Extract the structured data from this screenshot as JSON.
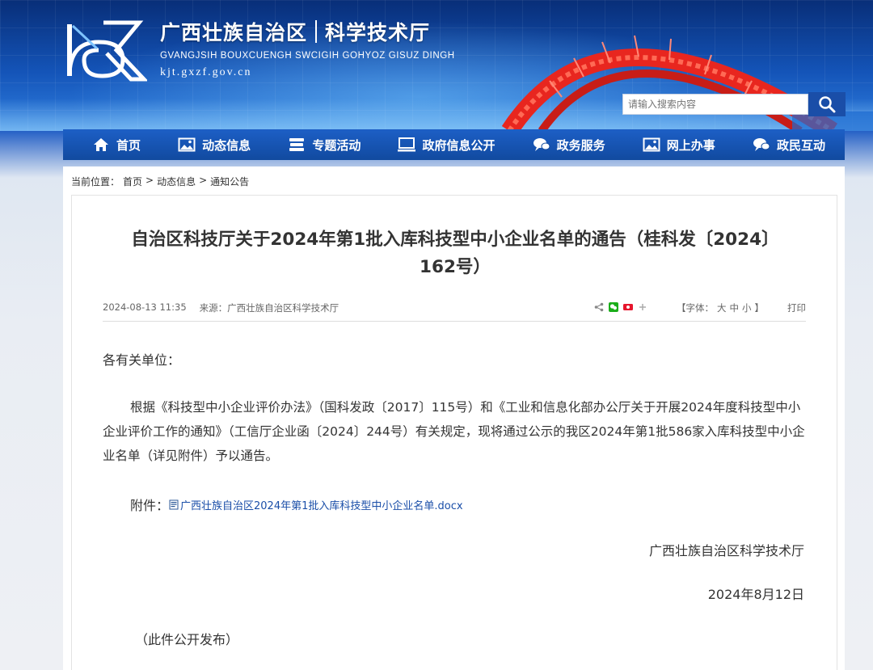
{
  "header": {
    "org_name": "广西壮族自治区",
    "dept_name": "科学技术厅",
    "romanized": "GVANGJSIH BOUXCUENGH SWCIGIH GOHYOZ GISUZ DINGH",
    "domain": "kjt.gxzf.gov.cn"
  },
  "search": {
    "placeholder": "请输入搜索内容"
  },
  "nav": {
    "items": [
      {
        "label": "首页",
        "icon": "home-icon"
      },
      {
        "label": "动态信息",
        "icon": "picture-icon"
      },
      {
        "label": "专题活动",
        "icon": "stack-icon"
      },
      {
        "label": "政府信息公开",
        "icon": "monitor-icon"
      },
      {
        "label": "政务服务",
        "icon": "chat-bubbles-icon"
      },
      {
        "label": "网上办事",
        "icon": "picture-icon"
      },
      {
        "label": "政民互动",
        "icon": "chat-bubbles-icon"
      }
    ]
  },
  "breadcrumb": {
    "prefix": "当前位置：",
    "items": [
      "首页",
      "动态信息",
      "通知公告"
    ],
    "separator": ">"
  },
  "article": {
    "title_line1": "自治区科技厅关于2024年第1批入库科技型中小企业名单的通告（桂科发〔2024〕",
    "title_line2": "162号）",
    "date": "2024-08-13 11:35",
    "source": "来源：广西壮族自治区科学技术厅",
    "font_label": "【字体：",
    "font_large": "大",
    "font_medium": "中",
    "font_small": "小",
    "font_close": "】",
    "print_label": "打印",
    "salutation": "各有关单位：",
    "paragraph": "根据《科技型中小企业评价办法》（国科发政〔2017〕115号）和《工业和信息化部办公厅关于开展2024年度科技型中小企业评价工作的通知》（工信厅企业函〔2024〕244号）有关规定，现将通过公示的我区2024年第1批586家入库科技型中小企业名单（详见附件）予以通告。",
    "attachment_label": "附件：",
    "attachment_file": "广西壮族自治区2024年第1批入库科技型中小企业名单.docx",
    "signer": "广西壮族自治区科学技术厅",
    "sign_date": "2024年8月12日",
    "note": "（此件公开发布）"
  },
  "colors": {
    "nav_bg": "#114a9f",
    "bridge_red": "#e8261f",
    "link_blue": "#1a4ea8"
  }
}
